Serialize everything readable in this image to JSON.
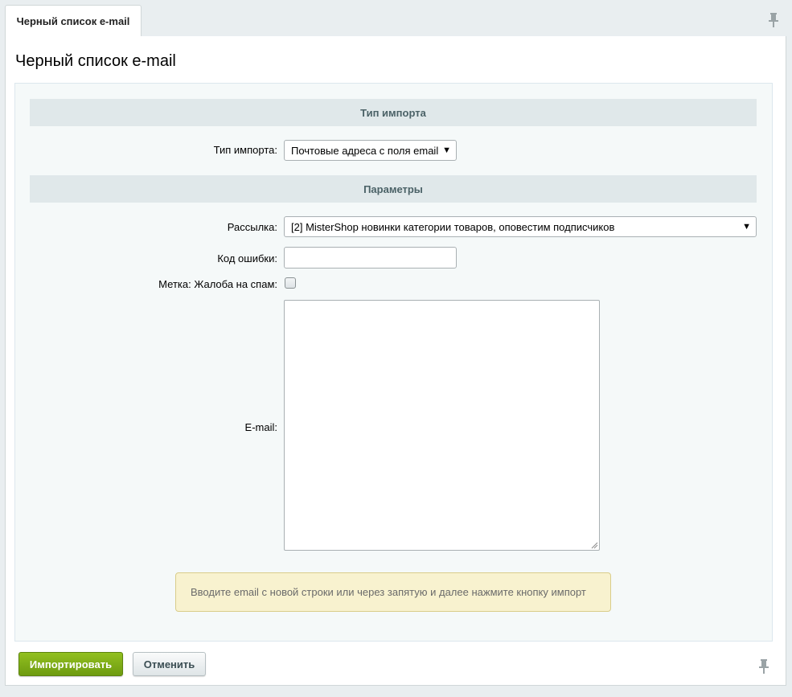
{
  "tab": {
    "label": "Черный список e-mail"
  },
  "page_title": "Черный список e-mail",
  "sections": {
    "import_type": "Тип импорта",
    "parameters": "Параметры"
  },
  "fields": {
    "import_type": {
      "label": "Тип импорта:",
      "value": "Почтовые адреса с поля email"
    },
    "mailing": {
      "label": "Рассылка:",
      "value": "[2] MisterShop новинки категории товаров, оповестим подписчиков"
    },
    "error_code": {
      "label": "Код ошибки:",
      "value": ""
    },
    "spam_flag": {
      "label": "Метка: Жалоба на спам:",
      "checked": false
    },
    "email": {
      "label": "E-mail:",
      "value": ""
    }
  },
  "hint": "Вводите email с новой строки или через запятую и далее нажмите кнопку импорт",
  "buttons": {
    "import": "Импортировать",
    "cancel": "Отменить"
  },
  "icons": {
    "pin_top": "pin-icon",
    "pin_bottom": "pin-icon",
    "dropdown": "dropdown-arrow-icon",
    "resize": "resize-grip-icon"
  },
  "colors": {
    "primary_button": "#7aa714",
    "section_header_bg": "#e0e8ea",
    "hint_bg": "#f8f2cf"
  }
}
